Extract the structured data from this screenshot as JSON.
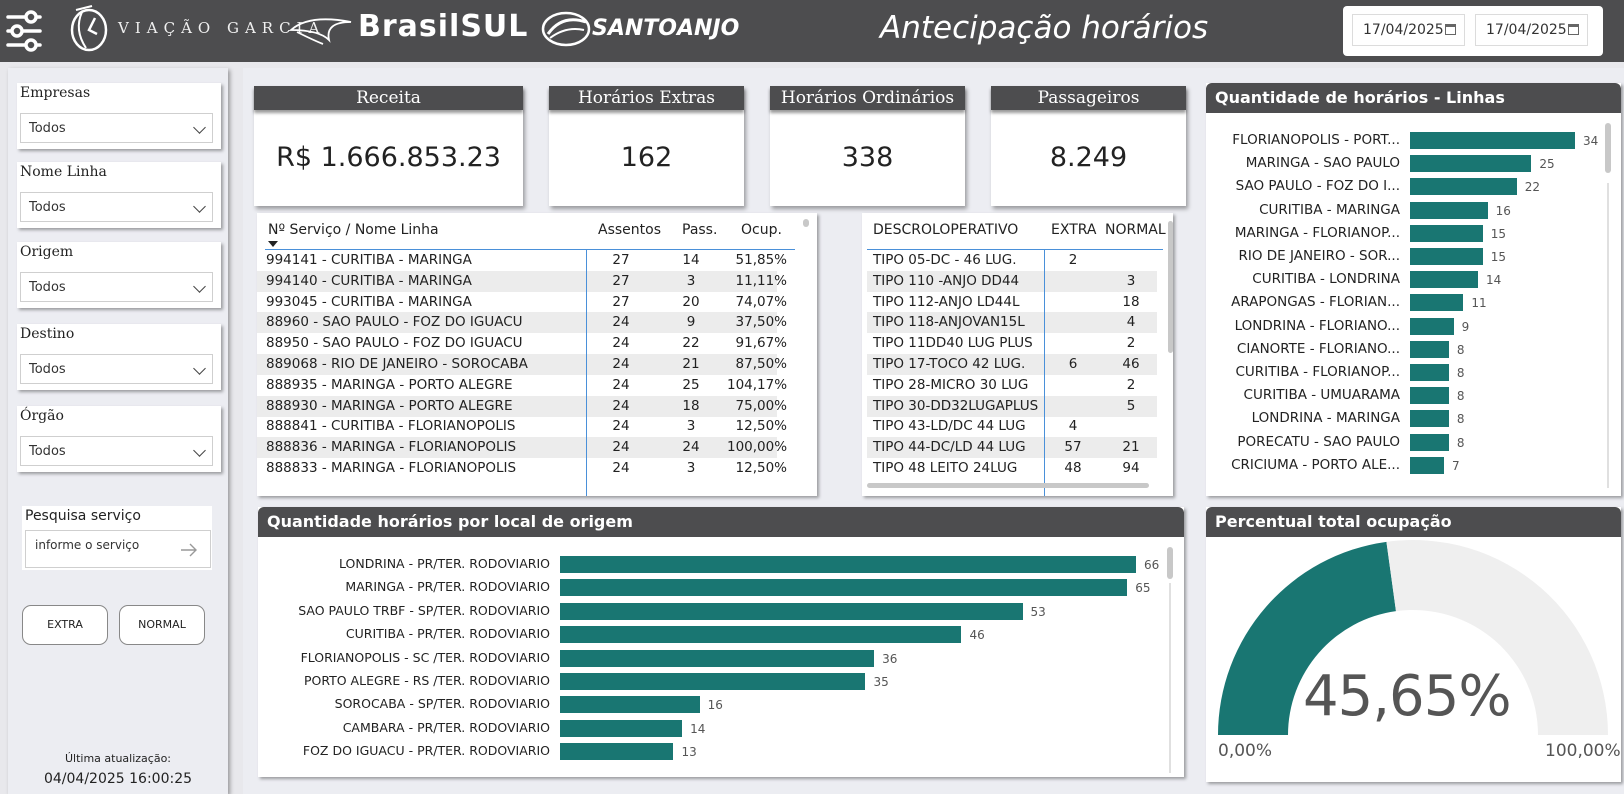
{
  "header": {
    "brand_garcia": "VIAÇÃO GARCIA",
    "brand_brasilsul": "BrasilSUL",
    "brand_santoanjo": "SANTOANJO",
    "title": "Antecipação horários",
    "date_start": "17/04/2025",
    "date_end": "17/04/2025"
  },
  "filters": [
    {
      "label": "Empresas",
      "value": "Todos"
    },
    {
      "label": "Nome Linha",
      "value": "Todos"
    },
    {
      "label": "Origem",
      "value": "Todos"
    },
    {
      "label": "Destino",
      "value": "Todos"
    },
    {
      "label": "Órgão",
      "value": "Todos"
    }
  ],
  "search": {
    "label": "Pesquisa serviço",
    "placeholder": "informe o serviço"
  },
  "buttons": {
    "extra": "EXTRA",
    "normal": "NORMAL"
  },
  "update": {
    "label": "Última atualização:",
    "value": "04/04/2025 16:00:25"
  },
  "kpis": [
    {
      "title": "Receita",
      "value": "R$ 1.666.853.23"
    },
    {
      "title": "Horários Extras",
      "value": "162"
    },
    {
      "title": "Horários Ordinários",
      "value": "338"
    },
    {
      "title": "Passageiros",
      "value": "8.249"
    }
  ],
  "service_table": {
    "columns": [
      "Nº Serviço / Nome Linha",
      "Assentos",
      "Pass.",
      "Ocup."
    ],
    "rows": [
      [
        "994141 - CURITIBA - MARINGA",
        "27",
        "14",
        "51,85%"
      ],
      [
        "994140 - CURITIBA - MARINGA",
        "27",
        "3",
        "11,11%"
      ],
      [
        "993045 - CURITIBA - MARINGA",
        "27",
        "20",
        "74,07%"
      ],
      [
        "88960 - SAO PAULO - FOZ DO IGUACU",
        "24",
        "9",
        "37,50%"
      ],
      [
        "88950 - SAO PAULO - FOZ DO IGUACU",
        "24",
        "22",
        "91,67%"
      ],
      [
        "889068 - RIO DE JANEIRO - SOROCABA",
        "24",
        "21",
        "87,50%"
      ],
      [
        "888935 - MARINGA - PORTO ALEGRE",
        "24",
        "25",
        "104,17%"
      ],
      [
        "888930 - MARINGA - PORTO ALEGRE",
        "24",
        "18",
        "75,00%"
      ],
      [
        "888841 - CURITIBA - FLORIANOPOLIS",
        "24",
        "3",
        "12,50%"
      ],
      [
        "888836 - MARINGA - FLORIANOPOLIS",
        "24",
        "24",
        "100,00%"
      ],
      [
        "888833 - MARINGA - FLORIANOPOLIS",
        "24",
        "3",
        "12,50%"
      ]
    ]
  },
  "type_table": {
    "columns": [
      "DESCROLOPERATIVO",
      "EXTRA",
      "NORMAL"
    ],
    "rows": [
      [
        "TIPO 05-DC - 46 LUG.",
        "2",
        ""
      ],
      [
        "TIPO 110 -ANJO DD44",
        "",
        "3"
      ],
      [
        "TIPO 112-ANJO LD44L",
        "",
        "18"
      ],
      [
        "TIPO 118-ANJOVAN15L",
        "",
        "4"
      ],
      [
        "TIPO 11DD40 LUG PLUS",
        "",
        "2"
      ],
      [
        "TIPO 17-TOCO 42 LUG.",
        "6",
        "46"
      ],
      [
        "TIPO 28-MICRO 30 LUG",
        "",
        "2"
      ],
      [
        "TIPO 30-DD32LUGAPLUS",
        "",
        "5"
      ],
      [
        "TIPO 43-LD/DC 44 LUG",
        "4",
        ""
      ],
      [
        "TIPO 44-DC/LD 44 LUG",
        "57",
        "21"
      ],
      [
        "TIPO 48 LEITO 24LUG",
        "48",
        "94"
      ]
    ]
  },
  "chart_lines": {
    "title": "Quantidade de horários - Linhas",
    "color": "#197672",
    "chart_data": {
      "type": "bar",
      "categories": [
        "FLORIANOPOLIS - PORT...",
        "MARINGA - SAO PAULO",
        "SAO PAULO - FOZ DO I...",
        "CURITIBA - MARINGA",
        "MARINGA - FLORIANOP...",
        "RIO DE JANEIRO - SOR...",
        "CURITIBA - LONDRINA",
        "ARAPONGAS - FLORIAN...",
        "LONDRINA - FLORIANO...",
        "CIANORTE - FLORIANO...",
        "CURITIBA - FLORIANOP...",
        "CURITIBA - UMUARAMA",
        "LONDRINA - MARINGA",
        "PORECATU - SAO PAULO",
        "CRICIUMA - PORTO ALE..."
      ],
      "values": [
        34,
        25,
        22,
        16,
        15,
        15,
        14,
        11,
        9,
        8,
        8,
        8,
        8,
        8,
        7
      ]
    }
  },
  "chart_origin": {
    "title": "Quantidade horários por local de origem",
    "color": "#197672",
    "chart_data": {
      "type": "bar",
      "categories": [
        "LONDRINA - PR/TER. RODOVIARIO",
        "MARINGA - PR/TER. RODOVIARIO",
        "SAO PAULO TRBF - SP/TER. RODOVIARIO",
        "CURITIBA - PR/TER. RODOVIARIO",
        "FLORIANOPOLIS - SC /TER. RODOVIARIO",
        "PORTO ALEGRE - RS /TER. RODOVIARIO",
        "SOROCABA - SP/TER. RODOVIARIO",
        "CAMBARA - PR/TER. RODOVIARIO",
        "FOZ DO IGUACU - PR/TER. RODOVIARIO"
      ],
      "values": [
        66,
        65,
        53,
        46,
        36,
        35,
        16,
        14,
        13
      ]
    }
  },
  "gauge": {
    "title": "Percentual total ocupação",
    "value_label": "45,65%",
    "value": 45.65,
    "min_label": "0,00%",
    "max_label": "100,00%",
    "fill_color": "#197672",
    "track_color": "#efefef"
  }
}
